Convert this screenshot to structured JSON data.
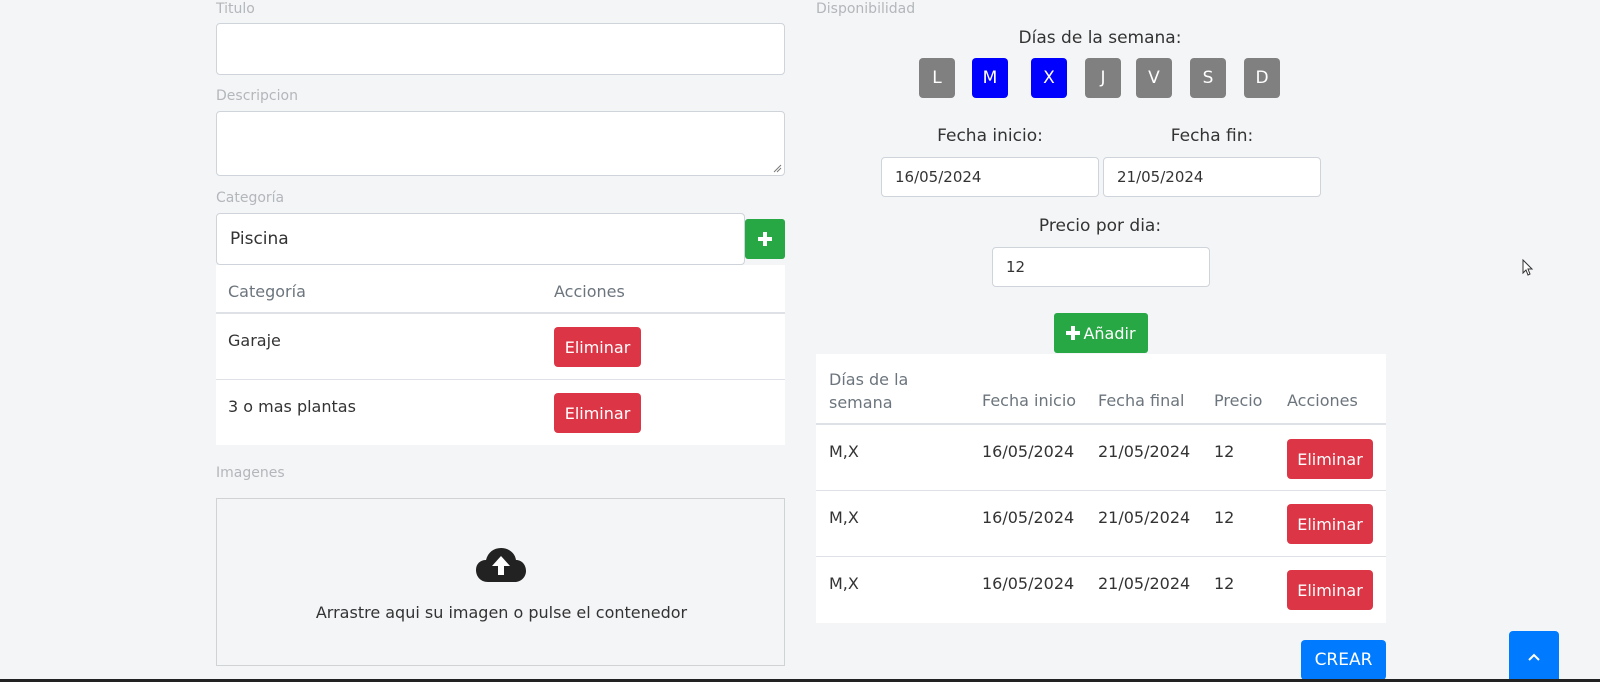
{
  "left": {
    "titulo_label": "Titulo",
    "titulo_value": "",
    "descripcion_label": "Descripcion",
    "descripcion_value": "",
    "categoria_label": "Categoría",
    "categoria_value": "Piscina",
    "cat_table": {
      "headers": [
        "Categoría",
        "Acciones"
      ],
      "rows": [
        {
          "name": "Garaje",
          "action": "Eliminar"
        },
        {
          "name": "3 o mas plantas",
          "action": "Eliminar"
        }
      ]
    },
    "imagenes_label": "Imagenes",
    "dropzone_text": "Arrastre aqui su imagen o pulse el contenedor"
  },
  "right": {
    "disponibilidad_label": "Disponibilidad",
    "dias_label": "Días de la semana:",
    "days": [
      {
        "label": "L",
        "selected": false
      },
      {
        "label": "M",
        "selected": true
      },
      {
        "label": "X",
        "selected": true
      },
      {
        "label": "J",
        "selected": false
      },
      {
        "label": "V",
        "selected": false
      },
      {
        "label": "S",
        "selected": false
      },
      {
        "label": "D",
        "selected": false
      }
    ],
    "fecha_inicio_label": "Fecha inicio:",
    "fecha_inicio_value": "16/05/2024",
    "fecha_fin_label": "Fecha fin:",
    "fecha_fin_value": "21/05/2024",
    "precio_label": "Precio por dia:",
    "precio_value": "12",
    "anadir_label": "Añadir",
    "disp_table": {
      "headers": [
        "Días de la semana",
        "Fecha inicio",
        "Fecha final",
        "Precio",
        "Acciones"
      ],
      "rows": [
        {
          "dias": "M,X",
          "inicio": "16/05/2024",
          "final": "21/05/2024",
          "precio": "12",
          "action": "Eliminar"
        },
        {
          "dias": "M,X",
          "inicio": "16/05/2024",
          "final": "21/05/2024",
          "precio": "12",
          "action": "Eliminar"
        },
        {
          "dias": "M,X",
          "inicio": "16/05/2024",
          "final": "21/05/2024",
          "precio": "12",
          "action": "Eliminar"
        }
      ]
    },
    "crear_label": "CREAR"
  },
  "colors": {
    "danger": "#dc3545",
    "success": "#28a745",
    "primary": "#007bff",
    "day_selected": "#0000ff",
    "day_unselected": "#808080"
  }
}
